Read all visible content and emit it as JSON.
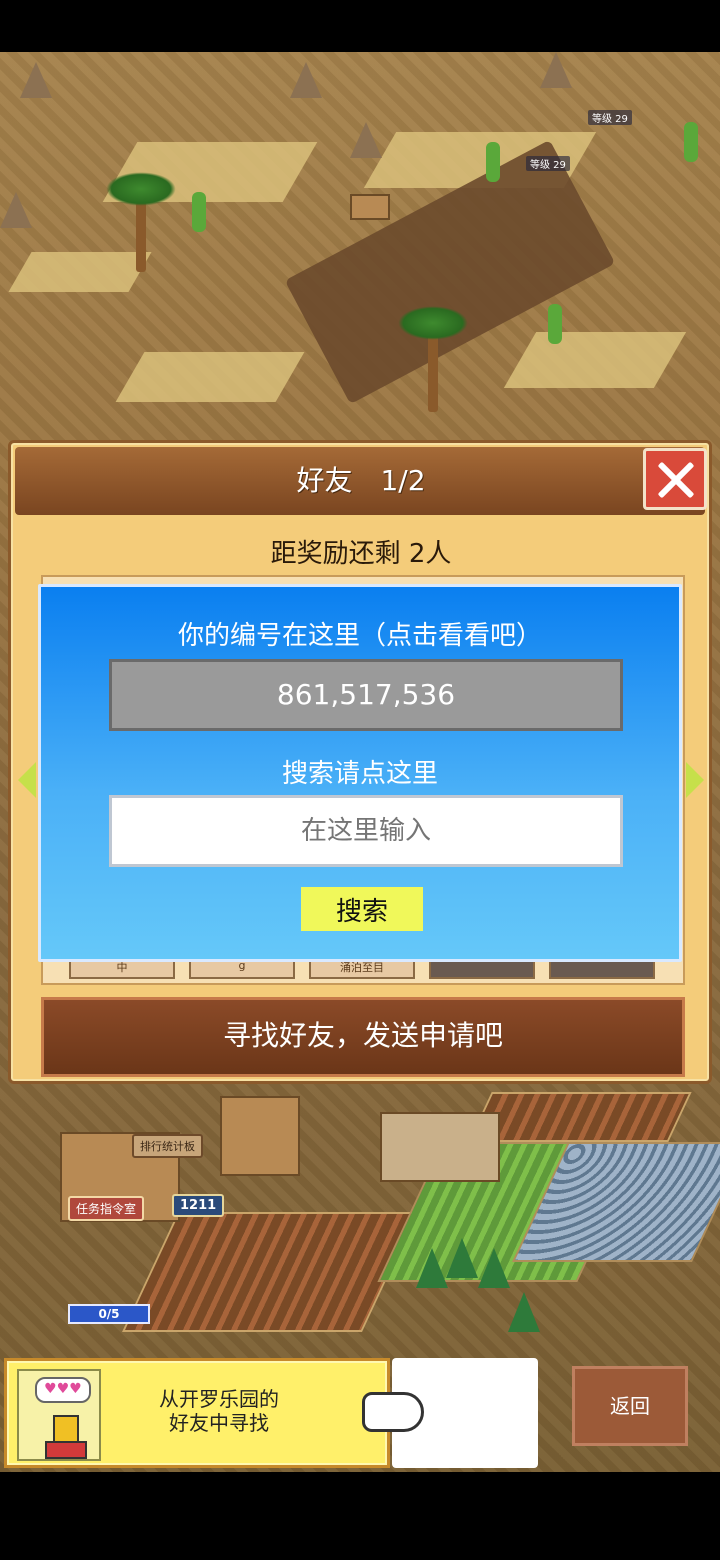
{
  "world": {
    "level_labels": [
      "等级 29",
      "等级 29"
    ],
    "signs": {
      "tasks_room": "任务指令室",
      "counter": "1211",
      "ranking": "排行统计板",
      "progress": "0/5"
    }
  },
  "friend_panel": {
    "title": "好友　1/2",
    "reward_remaining": "距奖励还剩 2人",
    "tab_stubs": [
      "中",
      "g",
      "涌泊至目",
      "",
      ""
    ],
    "id_dialog": {
      "id_label": "你的编号在这里（点击看看吧）",
      "player_id": "861,517,536",
      "search_label": "搜索请点这里",
      "search_placeholder": "在这里输入",
      "search_button": "搜索"
    },
    "find_friends_button": "寻找好友，发送申请吧"
  },
  "hint": {
    "line1": "从开罗乐园的",
    "line2": "好友中寻找",
    "bubble": "♥♥♥"
  },
  "back_button": "返回",
  "icons": {
    "close": "close-icon",
    "page_prev": "arrow-left-icon",
    "page_next": "arrow-right-icon",
    "pointer": "pointing-hand-icon"
  },
  "colors": {
    "panel_bg": "#f4cc7a",
    "dialog_blue": "#0a7ff0",
    "close_red": "#d94a3a",
    "search_yellow": "#f0f85a"
  }
}
